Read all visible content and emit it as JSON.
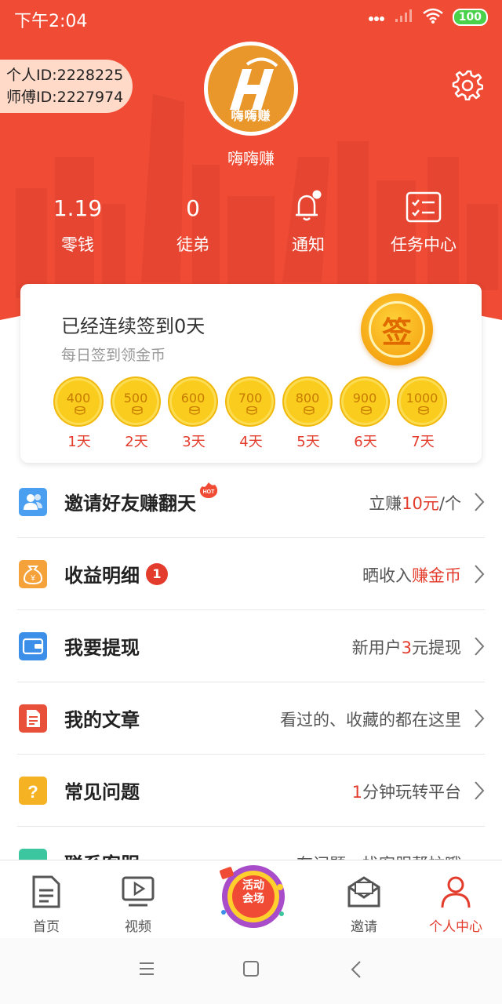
{
  "status_bar": {
    "time": "下午2:04",
    "battery": "100"
  },
  "profile": {
    "personal_id": "个人ID:2228225",
    "master_id": "师傅ID:2227974",
    "avatar_text": "嗨嗨赚",
    "username": "嗨嗨赚"
  },
  "stats": [
    {
      "value": "1.19",
      "label": "零钱",
      "type": "number"
    },
    {
      "value": "0",
      "label": "徒弟",
      "type": "number"
    },
    {
      "icon": "bell-icon",
      "label": "通知",
      "type": "icon"
    },
    {
      "icon": "task-list-icon",
      "label": "任务中心",
      "type": "icon"
    }
  ],
  "signin": {
    "title": "已经连续签到0天",
    "subtitle": "每日签到领金币",
    "coin_text": "签",
    "days": [
      {
        "amount": "400",
        "label": "1天"
      },
      {
        "amount": "500",
        "label": "2天"
      },
      {
        "amount": "600",
        "label": "3天"
      },
      {
        "amount": "700",
        "label": "4天"
      },
      {
        "amount": "800",
        "label": "5天"
      },
      {
        "amount": "900",
        "label": "6天"
      },
      {
        "amount": "1000",
        "label": "7天"
      }
    ]
  },
  "menu": [
    {
      "label": "邀请好友赚翻天",
      "icon": "invite-friends-icon",
      "icon_color": "#4b9ff0",
      "hot": "HOT",
      "right_pre": "立赚",
      "right_hl": "10元",
      "right_post": "/个"
    },
    {
      "label": "收益明细",
      "icon": "money-bag-icon",
      "icon_color": "#f5a23a",
      "badge": "1",
      "right_pre": "晒收入",
      "right_hl": "赚金币",
      "right_post": ""
    },
    {
      "label": "我要提现",
      "icon": "wallet-icon",
      "icon_color": "#3b8fe8",
      "right_pre": "新用户",
      "right_hl": "3",
      "right_post": "元提现"
    },
    {
      "label": "我的文章",
      "icon": "document-icon",
      "icon_color": "#e8503a",
      "right_pre": "看过的、收藏的都在这里",
      "right_hl": "",
      "right_post": ""
    },
    {
      "label": "常见问题",
      "icon": "question-icon",
      "icon_color": "#f5b324",
      "right_pre": "",
      "right_hl": "1",
      "right_post": "分钟玩转平台"
    },
    {
      "label": "联系客服",
      "icon": "customer-service-icon",
      "icon_color": "#3cc6a0",
      "right_pre": "有问题，找客服帮忙哦",
      "right_hl": "",
      "right_post": ""
    }
  ],
  "bottom_nav": [
    {
      "label": "首页",
      "icon": "home-doc-icon"
    },
    {
      "label": "视频",
      "icon": "video-icon"
    },
    {
      "label": "活动会场",
      "icon": "activity-center-icon"
    },
    {
      "label": "邀请",
      "icon": "invite-envelope-icon"
    },
    {
      "label": "个人中心",
      "icon": "profile-icon",
      "active": true
    }
  ],
  "colors": {
    "primary_red": "#f04b34",
    "highlight_red": "#e33c2c",
    "coin_gold": "#f9cc1d"
  }
}
